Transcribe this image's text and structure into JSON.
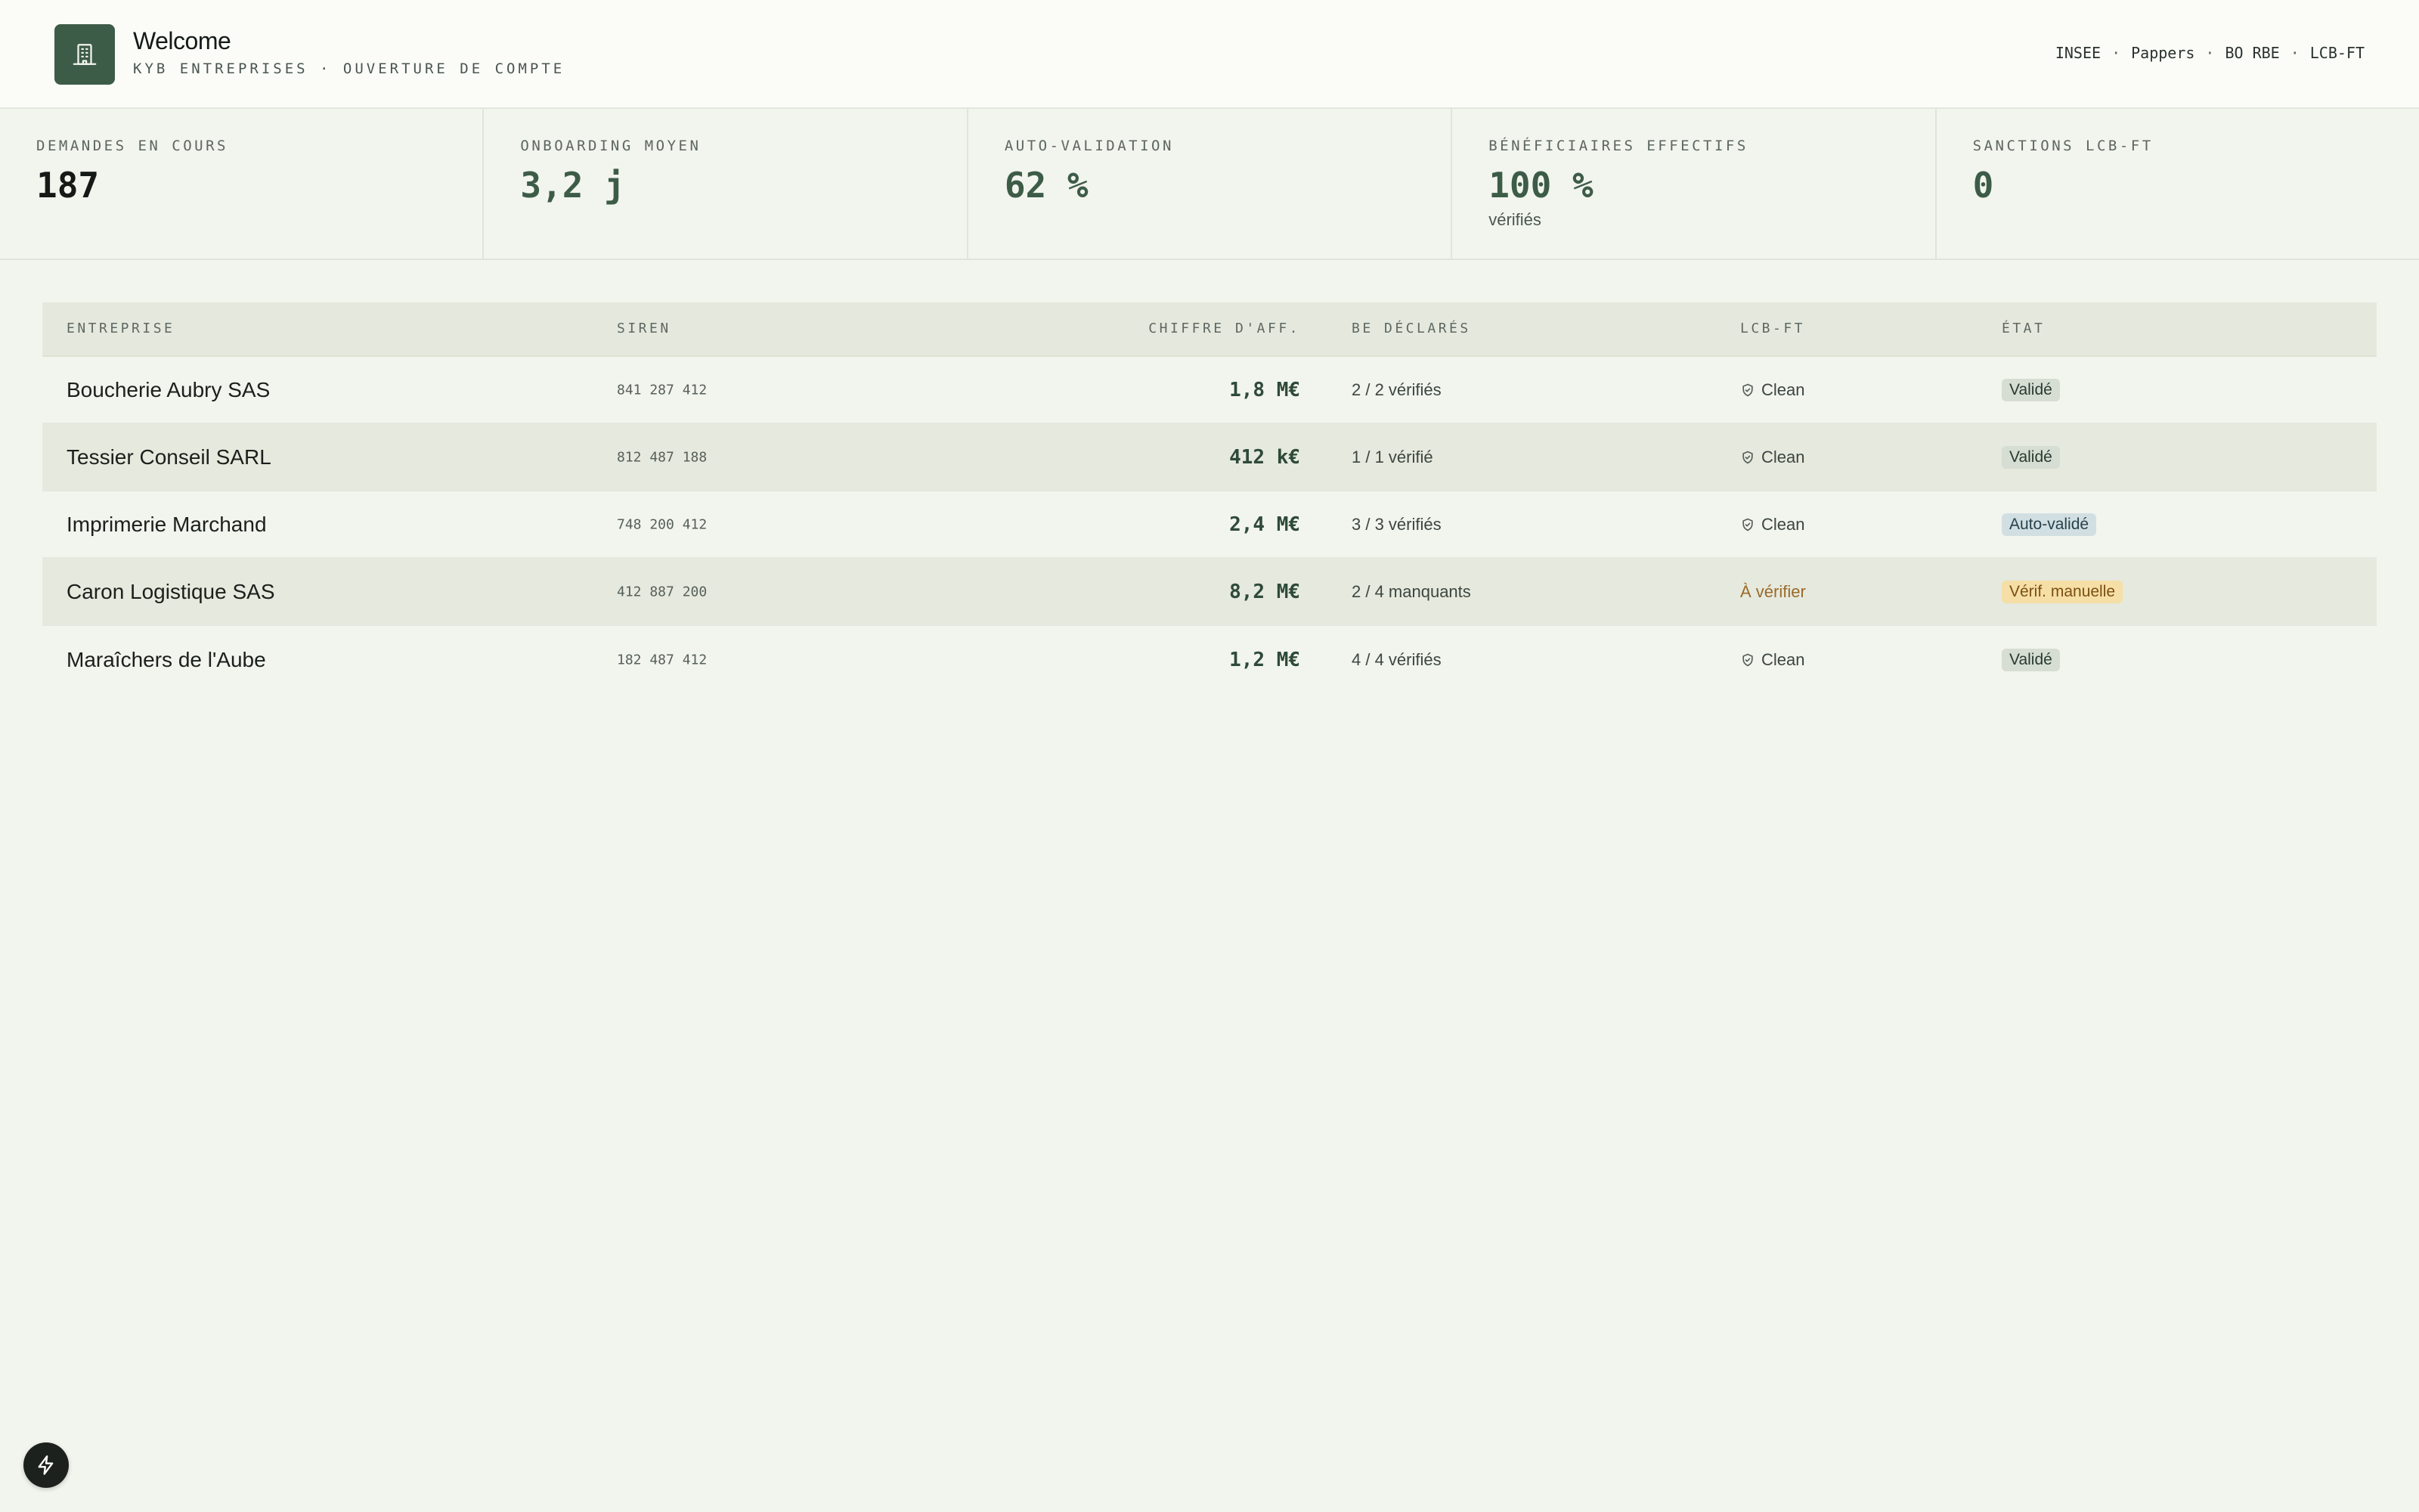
{
  "header": {
    "title": "Welcome",
    "subtitle": "KYB ENTREPRISES · OUVERTURE DE COMPTE",
    "sources": [
      "INSEE",
      "Pappers",
      "BO RBE",
      "LCB-FT"
    ],
    "source_separator": "·",
    "logo_icon": "building-icon"
  },
  "kpis": [
    {
      "label": "DEMANDES EN COURS",
      "value": "187",
      "sub": ""
    },
    {
      "label": "ONBOARDING MOYEN",
      "value": "3,2 j",
      "sub": ""
    },
    {
      "label": "AUTO-VALIDATION",
      "value": "62 %",
      "sub": ""
    },
    {
      "label": "BÉNÉFICIAIRES EFFECTIFS",
      "value": "100 %",
      "sub": "vérifiés"
    },
    {
      "label": "SANCTIONS LCB-FT",
      "value": "0",
      "sub": ""
    }
  ],
  "table": {
    "columns": {
      "entreprise": "ENTREPRISE",
      "siren": "SIREN",
      "ca": "CHIFFRE D'AFF.",
      "be": "BE DÉCLARÉS",
      "lcb": "LCB-FT",
      "etat": "ÉTAT"
    },
    "rows": [
      {
        "entreprise": "Boucherie Aubry SAS",
        "siren": "841 287 412",
        "ca": "1,8 M€",
        "be": "2 / 2 vérifiés",
        "lcb": "Clean",
        "etat": "Validé"
      },
      {
        "entreprise": "Tessier Conseil SARL",
        "siren": "812 487 188",
        "ca": "412 k€",
        "be": "1 / 1 vérifié",
        "lcb": "Clean",
        "etat": "Validé"
      },
      {
        "entreprise": "Imprimerie Marchand",
        "siren": "748 200 412",
        "ca": "2,4 M€",
        "be": "3 / 3 vérifiés",
        "lcb": "Clean",
        "etat": "Auto-validé"
      },
      {
        "entreprise": "Caron Logistique SAS",
        "siren": "412 887 200",
        "ca": "8,2 M€",
        "be": "2 / 4 manquants",
        "lcb": "À vérifier",
        "etat": "Vérif. manuelle"
      },
      {
        "entreprise": "Maraîchers de l'Aube",
        "siren": "182 487 412",
        "ca": "1,2 M€",
        "be": "4 / 4 vérifiés",
        "lcb": "Clean",
        "etat": "Validé"
      }
    ]
  },
  "colors": {
    "accent": "#3d5c48",
    "badge_validated": "#d6ddd3",
    "badge_auto": "#d2dfe2",
    "badge_manual": "#f6dfa6",
    "warning_text": "#9a6a2a"
  }
}
